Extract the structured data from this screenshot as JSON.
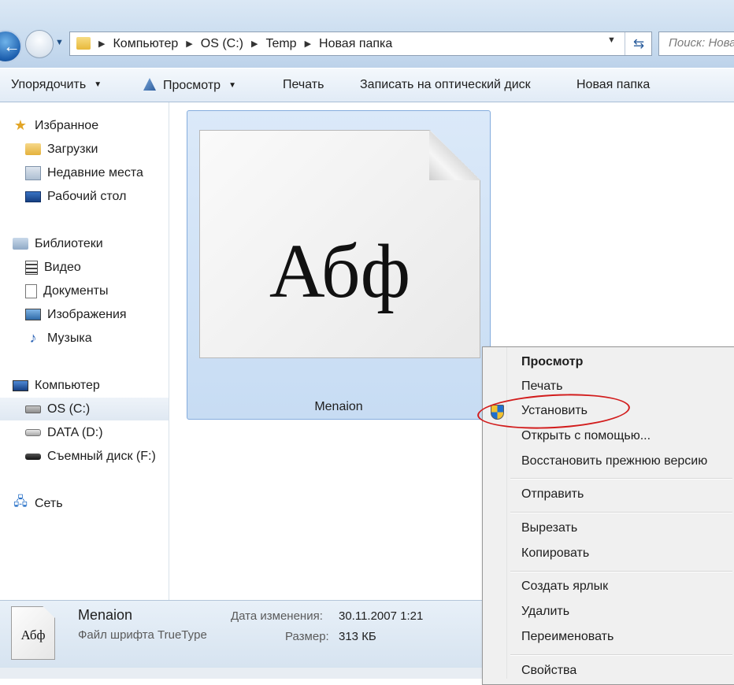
{
  "address_bar": {
    "breadcrumbs": [
      "Компьютер",
      "OS (C:)",
      "Temp",
      "Новая папка"
    ],
    "search_placeholder": "Поиск: Новая папка"
  },
  "toolbar": {
    "organize": "Упорядочить",
    "view": "Просмотр",
    "print": "Печать",
    "burn": "Записать на оптический диск",
    "new_folder": "Новая папка"
  },
  "nav": {
    "favorites": "Избранное",
    "downloads": "Загрузки",
    "recent": "Недавние места",
    "desktop": "Рабочий стол",
    "libraries": "Библиотеки",
    "video": "Видео",
    "documents": "Документы",
    "pictures": "Изображения",
    "music": "Музыка",
    "computer": "Компьютер",
    "drive_c": "OS (C:)",
    "drive_d": "DATA (D:)",
    "drive_f": "Съемный диск (F:)",
    "network": "Сеть"
  },
  "file": {
    "preview_text": "Абф",
    "name": "Menaion",
    "type": "Файл шрифта TrueType",
    "date_label": "Дата изменения:",
    "date_value": "30.11.2007 1:21",
    "size_label": "Размер:",
    "size_value": "313 КБ",
    "thumb_text": "Абф"
  },
  "context_menu": {
    "preview": "Просмотр",
    "print": "Печать",
    "install": "Установить",
    "open_with": "Открыть с помощью...",
    "restore": "Восстановить прежнюю версию",
    "send_to": "Отправить",
    "cut": "Вырезать",
    "copy": "Копировать",
    "create_shortcut": "Создать ярлык",
    "delete": "Удалить",
    "rename": "Переименовать",
    "properties": "Свойства"
  },
  "colors": {
    "highlight_oval": "#d21c1c",
    "selection": "#cfe2f7",
    "toolbar": "#e1ebf6"
  }
}
